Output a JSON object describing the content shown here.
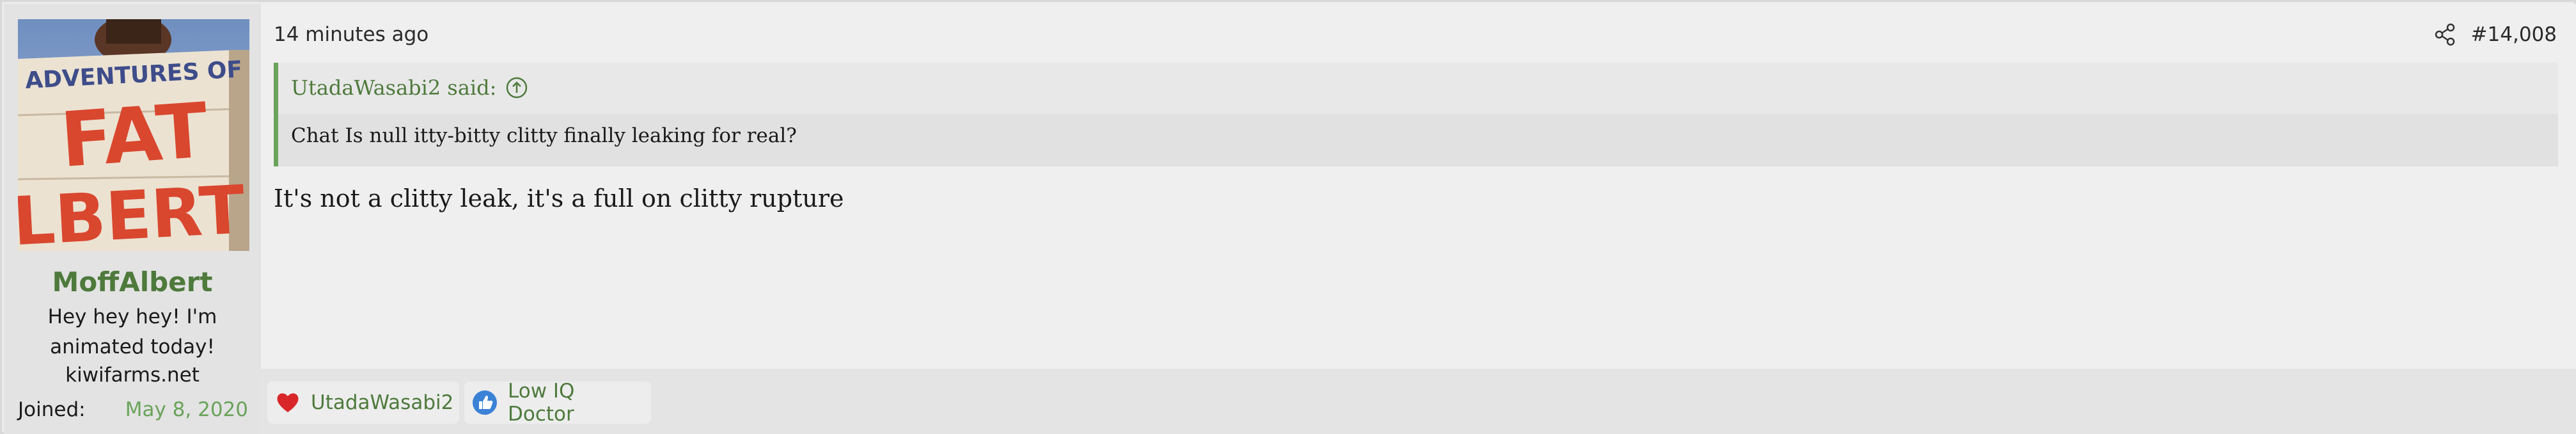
{
  "user": {
    "avatar_text_line1": "ADVENTURES OF",
    "avatar_text_line2": "FAT",
    "avatar_text_line3": "LBERT",
    "username": "MoffAlbert",
    "title_line1": "Hey hey hey! I'm",
    "title_line2": "animated today!",
    "site": "kiwifarms.net",
    "joined_label": "Joined:",
    "joined_date": "May 8, 2020"
  },
  "post": {
    "date": "14 minutes ago",
    "number": "#14,008",
    "quote_author": "UtadaWasabi2 said:",
    "quote_text": "Chat Is null itty-bitty clitty finally leaking for real?",
    "message": "It's not a clitty leak, it's a full on clitty rupture"
  },
  "reactions": [
    {
      "icon": "heart-icon",
      "name": "UtadaWasabi2"
    },
    {
      "icon": "thumbs-up-icon",
      "name": "Low IQ Doctor"
    }
  ],
  "colors": {
    "accent": "#4e7a3c",
    "accent_light": "#6aa35a",
    "heart": "#d9262a",
    "like": "#3b82d6"
  }
}
